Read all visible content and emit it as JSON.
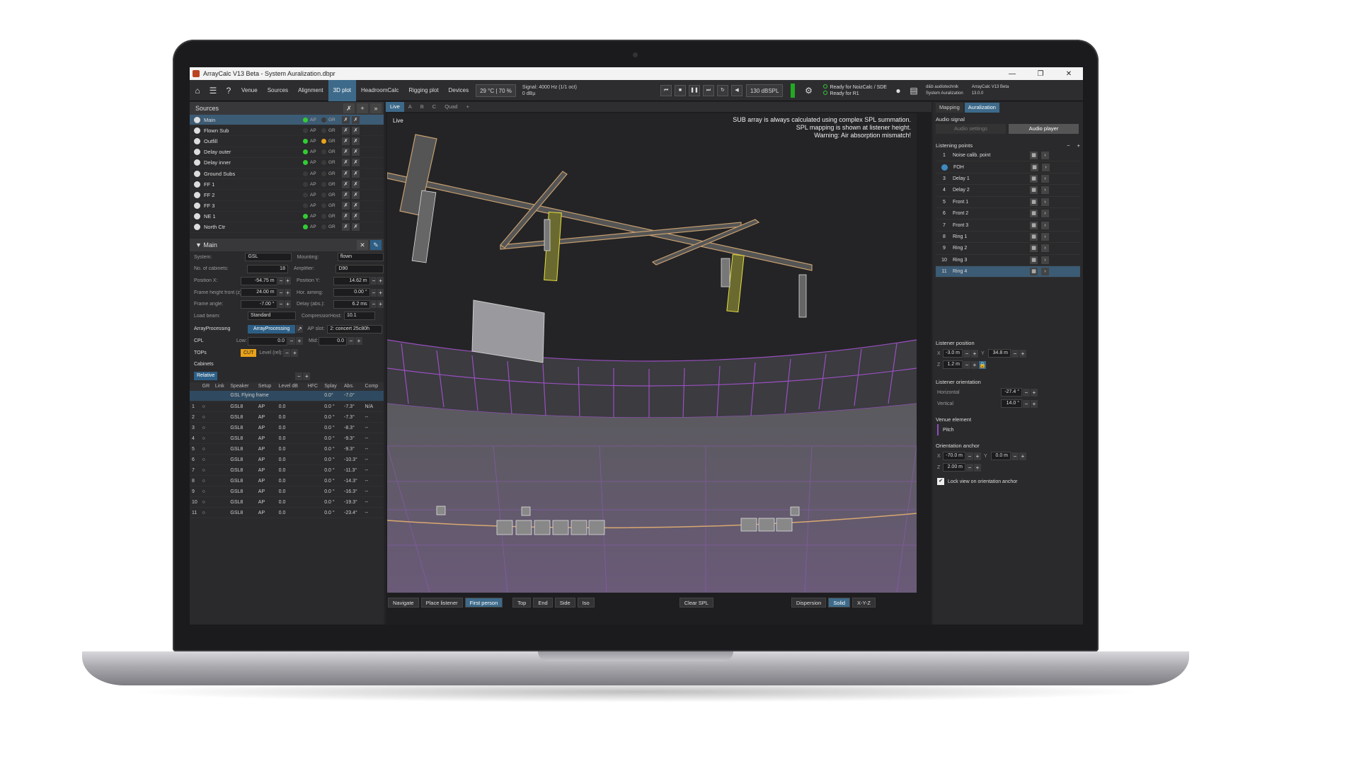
{
  "window": {
    "title": "ArrayCalc V13 Beta - System Auralization.dbpr",
    "min": "—",
    "max": "❐",
    "close": "✕"
  },
  "toolbar": {
    "tabs": [
      "Venue",
      "Sources",
      "Alignment",
      "3D plot",
      "HeadroomCalc",
      "Rigging plot",
      "Devices"
    ],
    "active_tab": "3D plot",
    "climate": "29 °C | 70 %",
    "signal_line1": "Signal: 4000 Hz (1/1 oct)",
    "signal_line2": "0 dBµ",
    "spl": "130 dBSPL",
    "ready1": "Ready for NoizCalc / SDE",
    "ready2": "Ready for R1",
    "company_line1": "d&b audiotechnik",
    "company_line2": "System Auralization",
    "version_line1": "ArrayCalc V13 Beta",
    "version_line2": "13.0.0"
  },
  "sources": {
    "title": "Sources",
    "items": [
      {
        "name": "Main",
        "ap": true,
        "gr": false,
        "sel": true
      },
      {
        "name": "Flown Sub",
        "ap": false,
        "gr": false
      },
      {
        "name": "Outfill",
        "ap": true,
        "gr": true
      },
      {
        "name": "Delay outer",
        "ap": true,
        "gr": false
      },
      {
        "name": "Delay inner",
        "ap": true,
        "gr": false
      },
      {
        "name": "Ground Subs",
        "ap": false,
        "gr": false
      },
      {
        "name": "FF 1",
        "ap": false,
        "gr": false
      },
      {
        "name": "FF 2",
        "ap": false,
        "gr": false
      },
      {
        "name": "FF 3",
        "ap": false,
        "gr": false
      },
      {
        "name": "NE 1",
        "ap": true,
        "gr": false
      },
      {
        "name": "North Ctr",
        "ap": true,
        "gr": false
      }
    ],
    "ap_label": "AP",
    "gr_label": "GR"
  },
  "main": {
    "title": "Main",
    "system_label": "System:",
    "system": "GSL",
    "mounting_label": "Mounting:",
    "mounting": "flown",
    "cabinets_label": "No. of cabinets:",
    "cabinets": "18",
    "amplifier_label": "Amplifier:",
    "amplifier": "D90",
    "posx_label": "Position X:",
    "posx": "-54.75 m",
    "posy_label": "Position Y:",
    "posy": "14.62 m",
    "frameh_label": "Frame height front (z):",
    "frameh": "24.00 m",
    "hor_label": "Hor. aiming:",
    "hor": "0.00 °",
    "framea_label": "Frame angle:",
    "framea": "-7.00 °",
    "delay_label": "Delay (abs.):",
    "delay": "6.2 ms",
    "load_label": "Load beam:",
    "load": "Standard",
    "compression_label": "Compression",
    "host_label": "Host:",
    "host": "10.1",
    "ap_label": "ArrayProcessing",
    "ap_btn": "ArrayProcessing",
    "ap_slot_label": "AP slot:",
    "ap_slot": "2: concert 25c80h",
    "cpl_label": "CPL",
    "low_label": "Low:",
    "low": "0.0",
    "mid_label": "Mid:",
    "mid": "0.0",
    "tops_label": "TOPs",
    "cut": "CUT",
    "level_label": "Level (rel):",
    "cabinets_title": "Cabinets",
    "relative": "Relative",
    "table_headers": [
      "",
      "GR",
      "Link",
      "Speaker",
      "Setup",
      "Level dB",
      "HFC",
      "Splay",
      "Abs.",
      "Comp"
    ],
    "frame_row": {
      "speaker": "GSL Flying frame",
      "splay": "0.0°",
      "abs": "-7.0°"
    },
    "rows": [
      {
        "n": "1",
        "spk": "GSL8",
        "setup": "AP",
        "level": "0.0",
        "splay": "0.0 °",
        "abs": "-7.3°",
        "comp": "N/A"
      },
      {
        "n": "2",
        "spk": "GSL8",
        "setup": "AP",
        "level": "0.0",
        "splay": "0.0 °",
        "abs": "-7.3°",
        "comp": "--"
      },
      {
        "n": "3",
        "spk": "GSL8",
        "setup": "AP",
        "level": "0.0",
        "splay": "0.0 °",
        "abs": "-8.3°",
        "comp": "--"
      },
      {
        "n": "4",
        "spk": "GSL8",
        "setup": "AP",
        "level": "0.0",
        "splay": "0.0 °",
        "abs": "-9.3°",
        "comp": "--"
      },
      {
        "n": "5",
        "spk": "GSL8",
        "setup": "AP",
        "level": "0.0",
        "splay": "0.0 °",
        "abs": "-9.3°",
        "comp": "--"
      },
      {
        "n": "6",
        "spk": "GSL8",
        "setup": "AP",
        "level": "0.0",
        "splay": "0.0 °",
        "abs": "-10.3°",
        "comp": "--"
      },
      {
        "n": "7",
        "spk": "GSL8",
        "setup": "AP",
        "level": "0.0",
        "splay": "0.0 °",
        "abs": "-11.3°",
        "comp": "--"
      },
      {
        "n": "8",
        "spk": "GSL8",
        "setup": "AP",
        "level": "0.0",
        "splay": "0.0 °",
        "abs": "-14.3°",
        "comp": "--"
      },
      {
        "n": "9",
        "spk": "GSL8",
        "setup": "AP",
        "level": "0.0",
        "splay": "0.0 °",
        "abs": "-16.3°",
        "comp": "--"
      },
      {
        "n": "10",
        "spk": "GSL8",
        "setup": "AP",
        "level": "0.0",
        "splay": "0.0 °",
        "abs": "-19.3°",
        "comp": "--"
      },
      {
        "n": "11",
        "spk": "GSL8",
        "setup": "AP",
        "level": "0.0",
        "splay": "0.0 °",
        "abs": "-23.4°",
        "comp": "--"
      }
    ]
  },
  "viewport": {
    "tabs": [
      "Live",
      "A",
      "B",
      "C",
      "Quad"
    ],
    "label": "Live",
    "warn1": "SUB array is always calculated using complex SPL summation.",
    "warn2": "SPL mapping is shown at listener height.",
    "warn3": "Warning: Air absorption mismatch!",
    "bottom": [
      "Navigate",
      "Place listener",
      "First person",
      "Top",
      "End",
      "Side",
      "Iso",
      "Clear SPL",
      "Dispersion",
      "Solid",
      "X-Y-Z"
    ]
  },
  "right": {
    "tabs": [
      "Mapping",
      "Auralization"
    ],
    "audio_signal": "Audio signal",
    "audio_settings": "Audio settings",
    "audio_player": "Audio player",
    "listening_points": "Listening points",
    "points": [
      {
        "n": "1",
        "name": "Noise calib. point"
      },
      {
        "n": "",
        "name": "FOH"
      },
      {
        "n": "3",
        "name": "Delay 1"
      },
      {
        "n": "4",
        "name": "Delay 2"
      },
      {
        "n": "5",
        "name": "Front 1"
      },
      {
        "n": "6",
        "name": "Front 2"
      },
      {
        "n": "7",
        "name": "Front 3"
      },
      {
        "n": "8",
        "name": "Ring 1"
      },
      {
        "n": "9",
        "name": "Ring 2"
      },
      {
        "n": "10",
        "name": "Ring 3"
      },
      {
        "n": "11",
        "name": "Ring 4"
      }
    ],
    "listener_position": "Listener position",
    "x_label": "X",
    "x": "-3.0 m",
    "y_label": "Y",
    "y": "34.8 m",
    "z_label": "Z",
    "z": "1.2 m",
    "listener_orientation": "Listener orientation",
    "horizontal_label": "Horizontal",
    "horizontal": "-27.4 °",
    "vertical_label": "Vertical",
    "vertical": "14.0 °",
    "venue_element": "Venue element",
    "pitch": "Pitch",
    "orientation_anchor": "Orientation anchor",
    "ax": "-70.0 m",
    "ay": "0.0 m",
    "az": "2.00 m",
    "lock": "Lock view on orientation anchor"
  }
}
